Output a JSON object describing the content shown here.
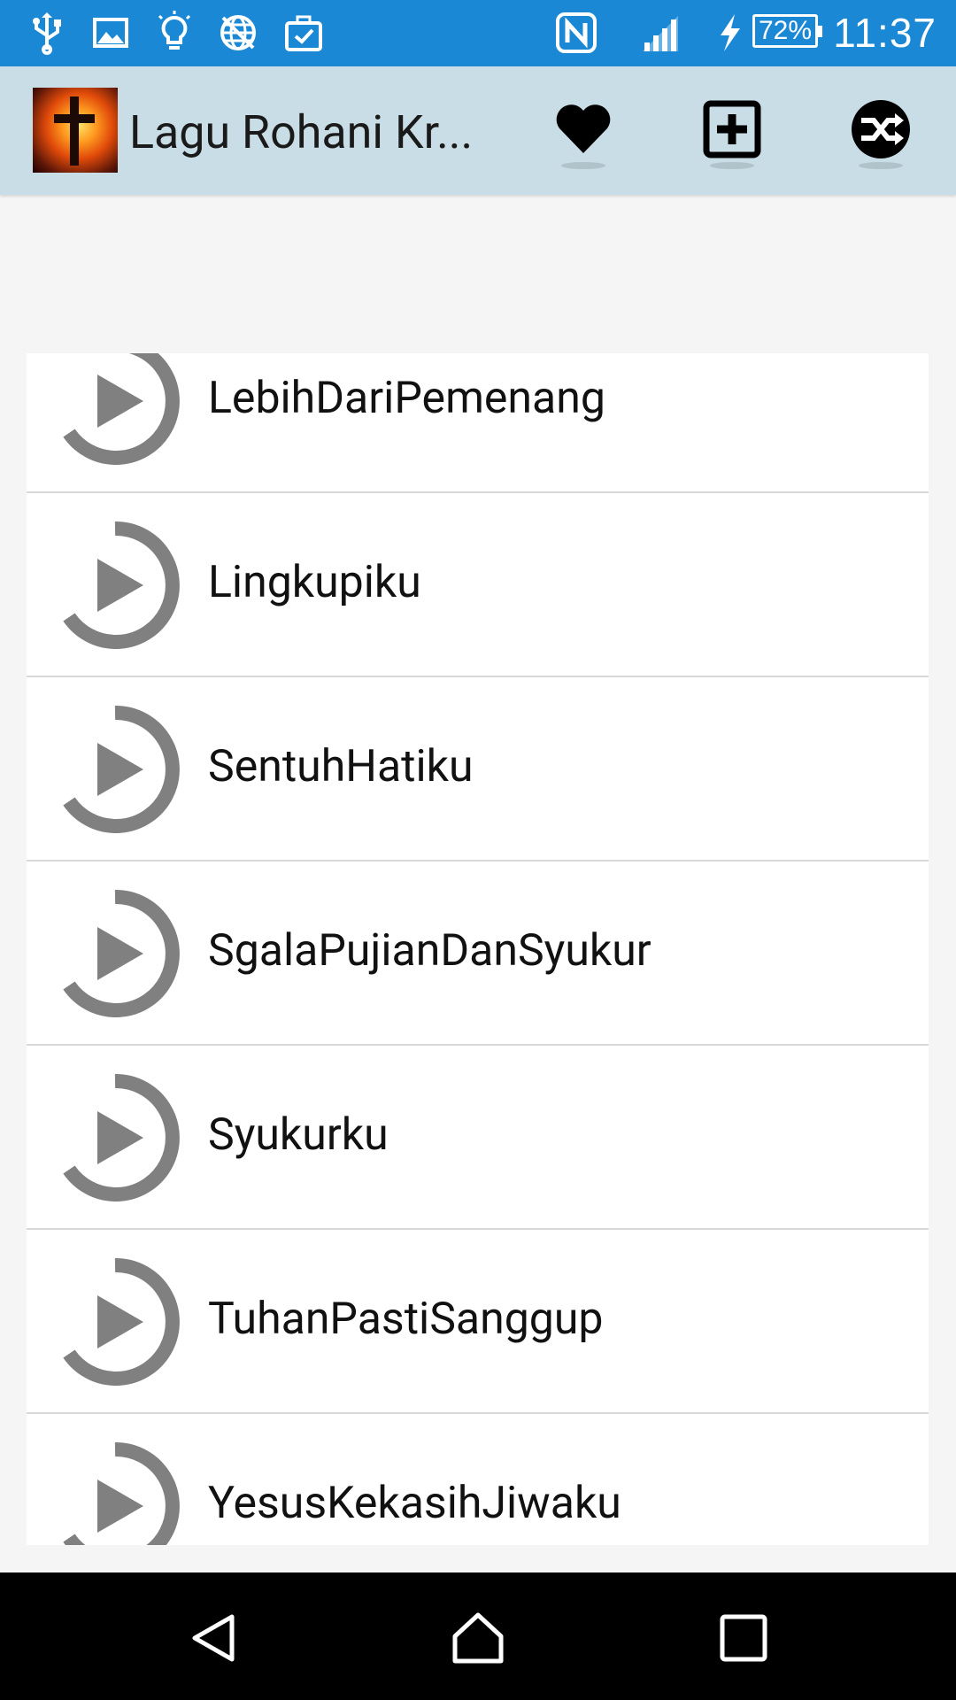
{
  "status_bar": {
    "time": "11:37",
    "battery": "72%",
    "icons": [
      "usb-icon",
      "image-icon",
      "bulb-icon",
      "no-network-icon",
      "briefcase-check-icon",
      "nfc-icon",
      "signal-icon",
      "charging-icon"
    ]
  },
  "app_bar": {
    "title": "Lagu Rohani Kr...",
    "actions": [
      "favorite-icon",
      "add-icon",
      "shuffle-icon"
    ]
  },
  "songs": [
    "LebihDariPemenang",
    "Lingkupiku",
    "SentuhHatiku",
    "SgalaPujianDanSyukur",
    "Syukurku",
    "TuhanPastiSanggup",
    "YesusKekasihJiwaku"
  ],
  "colors": {
    "status_bar": "#1b88d6",
    "app_bar": "#c9dde6",
    "play_icon": "#808080"
  },
  "nav_bar": [
    "back-icon",
    "home-icon",
    "recents-icon"
  ]
}
